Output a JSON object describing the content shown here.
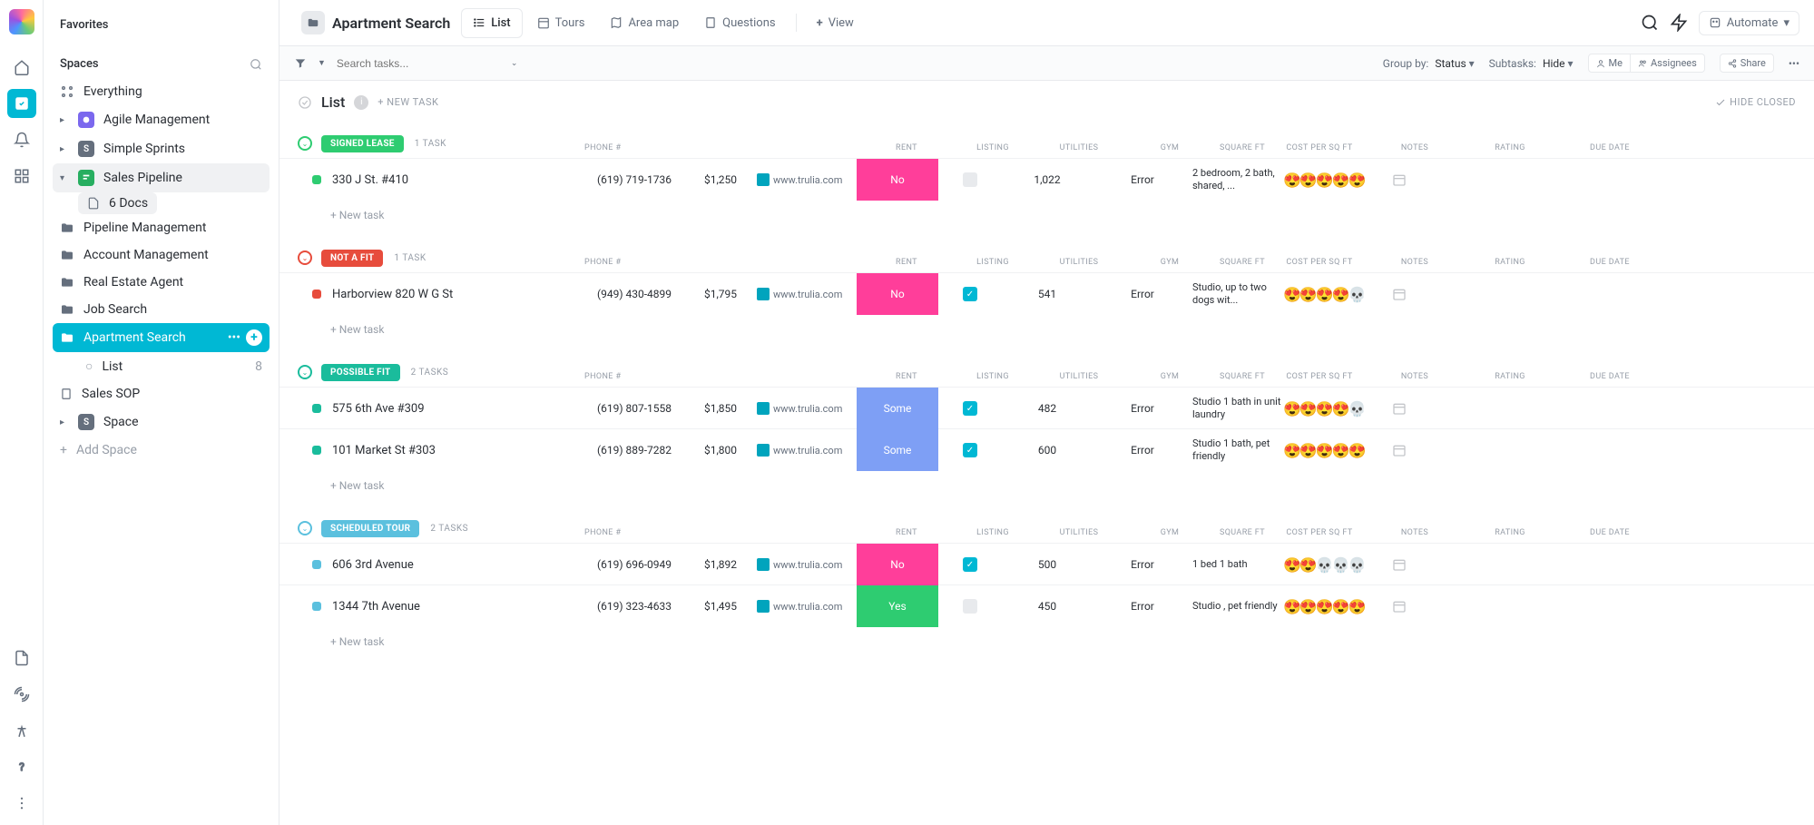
{
  "sidebar": {
    "favorites": "Favorites",
    "spaces": "Spaces",
    "everything": "Everything",
    "items": [
      {
        "label": "Agile Management",
        "color": "#7b68ee",
        "letter": ""
      },
      {
        "label": "Simple Sprints",
        "color": "#656f7d",
        "letter": "S"
      },
      {
        "label": "Sales Pipeline",
        "color": "#27ae60",
        "letter": ""
      }
    ],
    "docs_label": "6 Docs",
    "folders": [
      "Pipeline Management",
      "Account Management",
      "Real Estate Agent",
      "Job Search"
    ],
    "active_folder": "Apartment Search",
    "list_label": "List",
    "list_count": "8",
    "sales_sop": "Sales SOP",
    "space_label": "Space",
    "add_space": "Add Space"
  },
  "header": {
    "title": "Apartment Search",
    "tabs": [
      "List",
      "Tours",
      "Area map",
      "Questions"
    ],
    "view": "View",
    "automate": "Automate"
  },
  "toolbar": {
    "search_placeholder": "Search tasks...",
    "group_by_label": "Group by:",
    "group_by_value": "Status",
    "subtasks_label": "Subtasks:",
    "subtasks_value": "Hide",
    "me": "Me",
    "assignees": "Assignees",
    "share": "Share"
  },
  "list": {
    "title": "List",
    "new_task": "+ NEW TASK",
    "hide_closed": "HIDE CLOSED",
    "add_row": "+ New task"
  },
  "columns": [
    "PHONE #",
    "RENT",
    "LISTING",
    "UTILITIES",
    "GYM",
    "SQUARE FT",
    "COST PER SQ FT",
    "NOTES",
    "RATING",
    "DUE DATE"
  ],
  "groups": [
    {
      "status": "SIGNED LEASE",
      "color": "#2ecc71",
      "ring": "#2ecc71",
      "count": "1 TASK",
      "rows": [
        {
          "name": "330 J St. #410",
          "dot": "#2ecc71",
          "phone": "(619) 719-1736",
          "rent": "$1,250",
          "listing": "www.trulia.com",
          "util": "No",
          "util_color": "#ff3e9a",
          "gym": false,
          "sqft": "1,022",
          "cost": "Error",
          "notes": "2 bedroom, 2 bath, shared, ...",
          "rating": "😍😍😍😍😍"
        }
      ]
    },
    {
      "status": "NOT A FIT",
      "color": "#e74c3c",
      "ring": "#e74c3c",
      "count": "1 TASK",
      "rows": [
        {
          "name": "Harborview 820 W G St",
          "dot": "#e74c3c",
          "phone": "(949) 430-4899",
          "rent": "$1,795",
          "listing": "www.trulia.com",
          "util": "No",
          "util_color": "#ff3e9a",
          "gym": true,
          "sqft": "541",
          "cost": "Error",
          "notes": "Studio, up to two dogs wit...",
          "rating": "😍😍😍😍💀"
        }
      ]
    },
    {
      "status": "POSSIBLE FIT",
      "color": "#1abc9c",
      "ring": "#1abc9c",
      "count": "2 TASKS",
      "rows": [
        {
          "name": "575 6th Ave #309",
          "dot": "#1abc9c",
          "phone": "(619) 807-1558",
          "rent": "$1,850",
          "listing": "www.trulia.com",
          "util": "Some",
          "util_color": "#7e9ff5",
          "gym": true,
          "sqft": "482",
          "cost": "Error",
          "notes": "Studio 1 bath in unit laundry",
          "rating": "😍😍😍😍💀"
        },
        {
          "name": "101 Market St #303",
          "dot": "#1abc9c",
          "phone": "(619) 889-7282",
          "rent": "$1,800",
          "listing": "www.trulia.com",
          "util": "Some",
          "util_color": "#7e9ff5",
          "gym": true,
          "sqft": "600",
          "cost": "Error",
          "notes": "Studio 1 bath, pet friendly",
          "rating": "😍😍😍😍😍"
        }
      ]
    },
    {
      "status": "SCHEDULED TOUR",
      "color": "#5bc0de",
      "ring": "#5bc0de",
      "count": "2 TASKS",
      "rows": [
        {
          "name": "606 3rd Avenue",
          "dot": "#5bc0de",
          "phone": "(619) 696-0949",
          "rent": "$1,892",
          "listing": "www.trulia.com",
          "util": "No",
          "util_color": "#ff3e9a",
          "gym": true,
          "sqft": "500",
          "cost": "Error",
          "notes": "1 bed 1 bath",
          "rating": "😍😍💀💀💀"
        },
        {
          "name": "1344 7th Avenue",
          "dot": "#5bc0de",
          "phone": "(619) 323-4633",
          "rent": "$1,495",
          "listing": "www.trulia.com",
          "util": "Yes",
          "util_color": "#2ecc71",
          "gym": false,
          "sqft": "450",
          "cost": "Error",
          "notes": "Studio , pet friendly",
          "rating": "😍😍😍😍😍"
        }
      ]
    }
  ]
}
